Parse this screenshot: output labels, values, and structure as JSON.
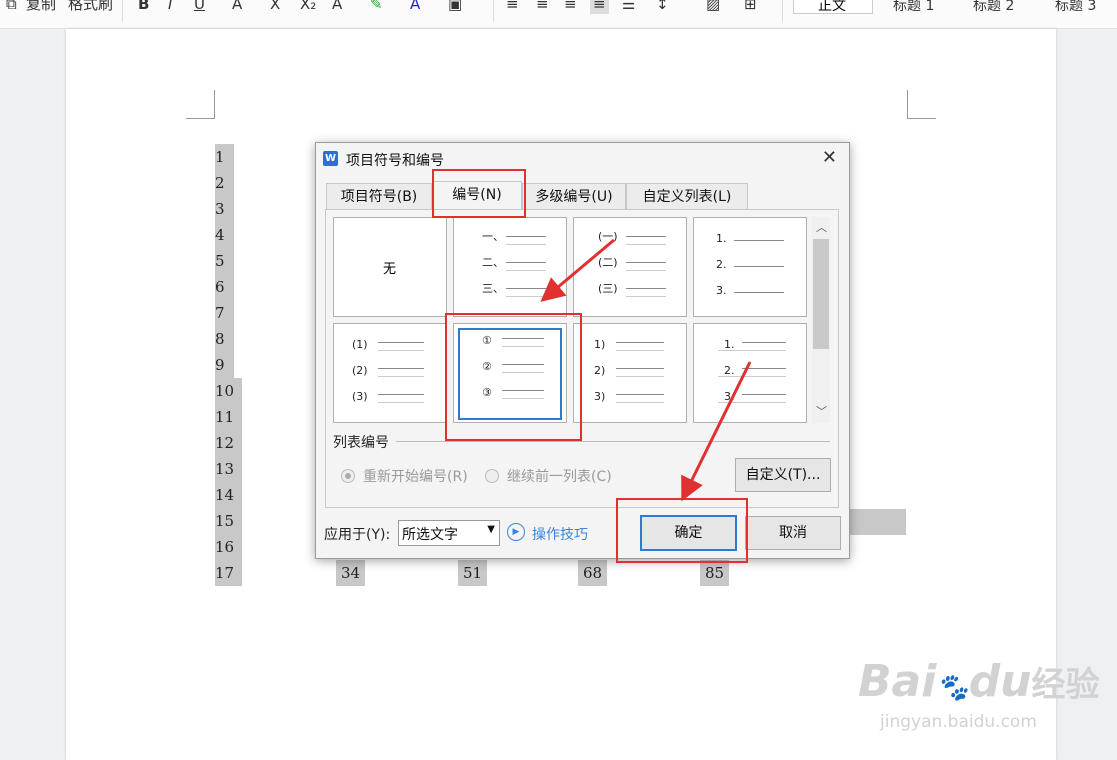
{
  "toolbar": {
    "copy_label": "复制",
    "format_painter_label": "格式刷",
    "styles": [
      "正文",
      "标题 1",
      "标题 2",
      "标题 3"
    ]
  },
  "document": {
    "column1": [
      "1",
      "2",
      "3",
      "4",
      "5",
      "6",
      "7",
      "8",
      "9",
      "10",
      "11",
      "12",
      "13",
      "14",
      "15",
      "16",
      "17"
    ],
    "bottom_row": [
      "34",
      "51",
      "68",
      "85"
    ]
  },
  "dialog": {
    "title": "项目符号和编号",
    "close_icon": "close-icon",
    "tabs": [
      "项目符号(B)",
      "编号(N)",
      "多级编号(U)",
      "自定义列表(L)"
    ],
    "active_tab": "编号(N)",
    "styles": {
      "none": "无",
      "chinese_dun": [
        "一、",
        "二、",
        "三、"
      ],
      "chinese_paren": [
        "(一)",
        "(二)",
        "(三)"
      ],
      "digit_dot": [
        "1.",
        "2.",
        "3."
      ],
      "digit_paren_full": [
        "(1)",
        "(2)",
        "(3)"
      ],
      "circled": [
        "①",
        "②",
        "③"
      ],
      "digit_half_paren": [
        "1)",
        "2)",
        "3)"
      ],
      "digit_dot_lines": [
        "1.",
        "2.",
        "3."
      ]
    },
    "selected_style": "circled",
    "list_numbering_label": "列表编号",
    "restart_label": "重新开始编号(R)",
    "continue_label": "继续前一列表(C)",
    "customize_button": "自定义(T)...",
    "apply_to_label": "应用于(Y):",
    "apply_to_value": "所选文字",
    "tips_label": "操作技巧",
    "ok_button": "确定",
    "cancel_button": "取消"
  },
  "watermark": {
    "brand": "Bai",
    "brand2": "du",
    "site_cn": "经验",
    "url": "jingyan.baidu.com"
  },
  "colors": {
    "accent": "#2c7bd0",
    "highlight_red": "#e03030",
    "arrow_red": "#e03030",
    "selection_gray": "#c8c8c8"
  }
}
